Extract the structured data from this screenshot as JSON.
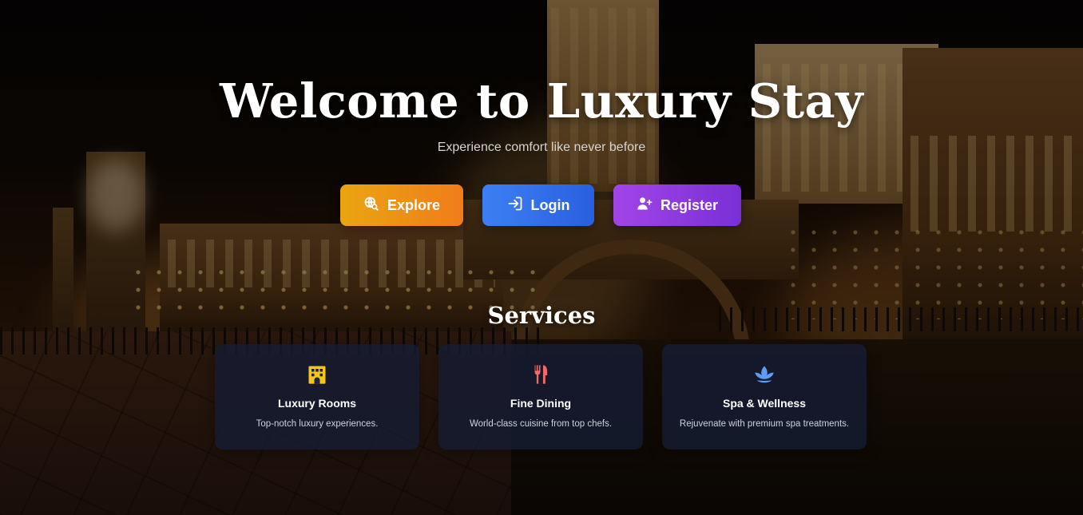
{
  "hero": {
    "title": "Welcome to Luxury Stay",
    "subtitle": "Experience comfort like never before"
  },
  "actions": {
    "explore": {
      "label": "Explore",
      "icon": "globe-search-icon",
      "color_from": "#eaa512",
      "color_to": "#f07c1a"
    },
    "login": {
      "label": "Login",
      "icon": "login-arrow-icon",
      "color_from": "#3c7ff2",
      "color_to": "#2a5fe0"
    },
    "register": {
      "label": "Register",
      "icon": "user-plus-icon",
      "color_from": "#a145e8",
      "color_to": "#7a2fd6"
    }
  },
  "services": {
    "title": "Services",
    "items": [
      {
        "title": "Luxury Rooms",
        "description": "Top-notch luxury experiences.",
        "icon": "hotel-building-icon",
        "icon_color": "#f5c518"
      },
      {
        "title": "Fine Dining",
        "description": "World-class cuisine from top chefs.",
        "icon": "fork-knife-icon",
        "icon_color": "#f06a6a"
      },
      {
        "title": "Spa & Wellness",
        "description": "Rejuvenate with premium spa treatments.",
        "icon": "lotus-spa-icon",
        "icon_color": "#5b9cf5"
      }
    ]
  }
}
